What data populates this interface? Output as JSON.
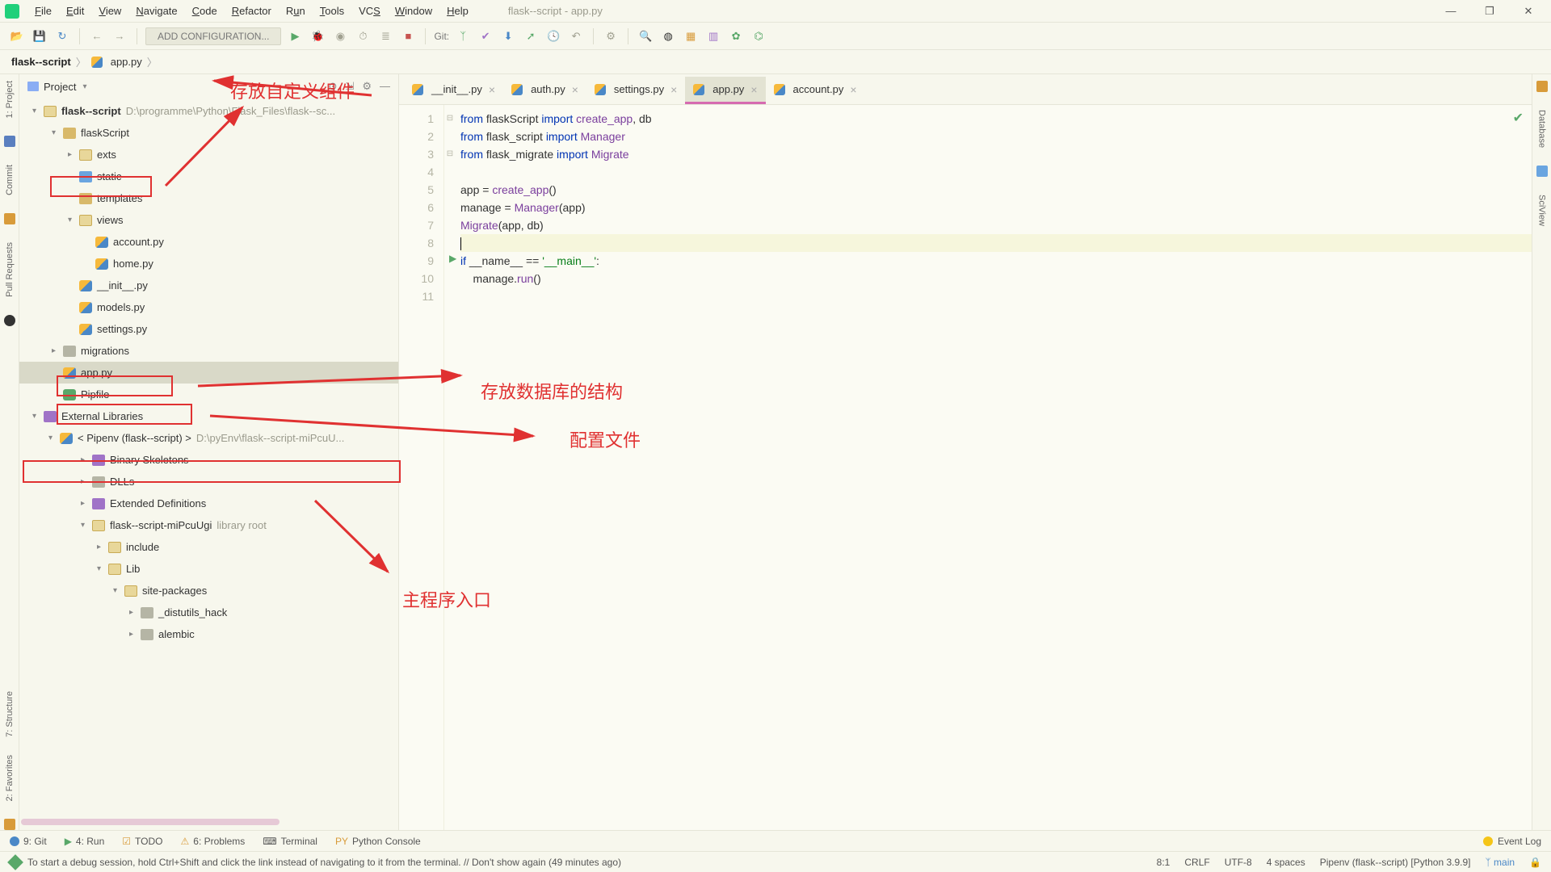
{
  "window": {
    "title": "flask--script - app.py"
  },
  "menus": [
    "File",
    "Edit",
    "View",
    "Navigate",
    "Code",
    "Refactor",
    "Run",
    "Tools",
    "VCS",
    "Window",
    "Help"
  ],
  "toolbar": {
    "add_configuration": "ADD CONFIGURATION...",
    "vcs_label": "Git:"
  },
  "breadcrumb": {
    "root": "flask--script",
    "file": "app.py"
  },
  "left_sidebar": [
    "1: Project",
    "Commit",
    "Pull Requests",
    "2: Favorites",
    "7: Structure"
  ],
  "right_sidebar": [
    "Database",
    "SciView"
  ],
  "project": {
    "header": "Project",
    "root_name": "flask--script",
    "root_path": "D:\\programme\\Python\\Flask_Files\\flask--sc...",
    "nodes": [
      {
        "indent": 1,
        "arrow": "▾",
        "icon": "folder",
        "label": "flaskScript"
      },
      {
        "indent": 2,
        "arrow": "▸",
        "icon": "folder-o",
        "label": "exts",
        "box": "exts"
      },
      {
        "indent": 2,
        "arrow": "",
        "icon": "folder-b",
        "label": "static"
      },
      {
        "indent": 2,
        "arrow": "",
        "icon": "folder",
        "label": "templates"
      },
      {
        "indent": 2,
        "arrow": "▾",
        "icon": "folder-o",
        "label": "views"
      },
      {
        "indent": 3,
        "arrow": "",
        "icon": "py",
        "label": "account.py"
      },
      {
        "indent": 3,
        "arrow": "",
        "icon": "py",
        "label": "home.py"
      },
      {
        "indent": 2,
        "arrow": "",
        "icon": "py",
        "label": "__init__.py"
      },
      {
        "indent": 2,
        "arrow": "",
        "icon": "py",
        "label": "models.py",
        "box": "models"
      },
      {
        "indent": 2,
        "arrow": "",
        "icon": "py",
        "label": "settings.py",
        "box": "settings"
      },
      {
        "indent": 1,
        "arrow": "▸",
        "icon": "folder-gray",
        "label": "migrations"
      },
      {
        "indent": 1,
        "arrow": "",
        "icon": "py",
        "label": "app.py",
        "sel": true,
        "box": "app"
      },
      {
        "indent": 1,
        "arrow": "",
        "icon": "pkg",
        "label": "Pipfile"
      }
    ],
    "ext_lib": "External Libraries",
    "pipenv": "< Pipenv (flask--script) >",
    "pipenv_path": "D:\\pyEnv\\flask--script-miPcuU...",
    "libs": [
      {
        "indent": 2,
        "arrow": "▸",
        "icon": "lib",
        "label": "Binary Skeletons"
      },
      {
        "indent": 2,
        "arrow": "▸",
        "icon": "folder-gray",
        "label": "DLLs"
      },
      {
        "indent": 2,
        "arrow": "▸",
        "icon": "lib",
        "label": "Extended Definitions"
      },
      {
        "indent": 2,
        "arrow": "▾",
        "icon": "folder-o",
        "label": "flask--script-miPcuUgi",
        "dim": "library root"
      },
      {
        "indent": 3,
        "arrow": "▸",
        "icon": "folder-o",
        "label": "include"
      },
      {
        "indent": 3,
        "arrow": "▾",
        "icon": "folder-o",
        "label": "Lib"
      },
      {
        "indent": 4,
        "arrow": "▾",
        "icon": "folder-o",
        "label": "site-packages"
      },
      {
        "indent": 5,
        "arrow": "▸",
        "icon": "folder-gray",
        "label": "_distutils_hack"
      },
      {
        "indent": 5,
        "arrow": "▸",
        "icon": "folder-gray",
        "label": "alembic"
      }
    ]
  },
  "tabs": [
    {
      "label": "__init__.py",
      "active": false
    },
    {
      "label": "auth.py",
      "active": false
    },
    {
      "label": "settings.py",
      "active": false
    },
    {
      "label": "app.py",
      "active": true
    },
    {
      "label": "account.py",
      "active": false
    }
  ],
  "code": {
    "lines": [
      {
        "n": 1,
        "fold": "⊟",
        "txt": "from flaskScript import create_app, db",
        "kw": "from|import"
      },
      {
        "n": 2,
        "fold": "",
        "txt": "from flask_script import Manager",
        "kw": "from|import"
      },
      {
        "n": 3,
        "fold": "⊟",
        "txt": "from flask_migrate import Migrate",
        "kw": "from|import"
      },
      {
        "n": 4,
        "fold": "",
        "txt": ""
      },
      {
        "n": 5,
        "fold": "",
        "txt": "app = create_app()"
      },
      {
        "n": 6,
        "fold": "",
        "txt": "manage = Manager(app)"
      },
      {
        "n": 7,
        "fold": "",
        "txt": "Migrate(app, db)"
      },
      {
        "n": 8,
        "fold": "",
        "txt": "",
        "hl": true,
        "cursor": true
      },
      {
        "n": 9,
        "fold": "▶",
        "txt": "if __name__ == '__main__':",
        "kw": "if"
      },
      {
        "n": 10,
        "fold": "",
        "txt": "    manage.run()"
      },
      {
        "n": 11,
        "fold": "",
        "txt": ""
      }
    ]
  },
  "annotations": {
    "a1": "存放自定义组件",
    "a2": "存放数据库的结构",
    "a3": "配置文件",
    "a4": "主程序入口"
  },
  "toolstrip": {
    "git": "9: Git",
    "run": "4: Run",
    "todo": "TODO",
    "problems": "6: Problems",
    "terminal": "Terminal",
    "pyconsole": "Python Console",
    "eventlog": "Event Log"
  },
  "status": {
    "msg": "To start a debug session, hold Ctrl+Shift and click the link instead of navigating to it from the terminal. // Don't show again (49 minutes ago)",
    "pos": "8:1",
    "eol": "CRLF",
    "enc": "UTF-8",
    "indent": "4 spaces",
    "interp": "Pipenv (flask--script) [Python 3.9.9]",
    "branch": "main"
  }
}
